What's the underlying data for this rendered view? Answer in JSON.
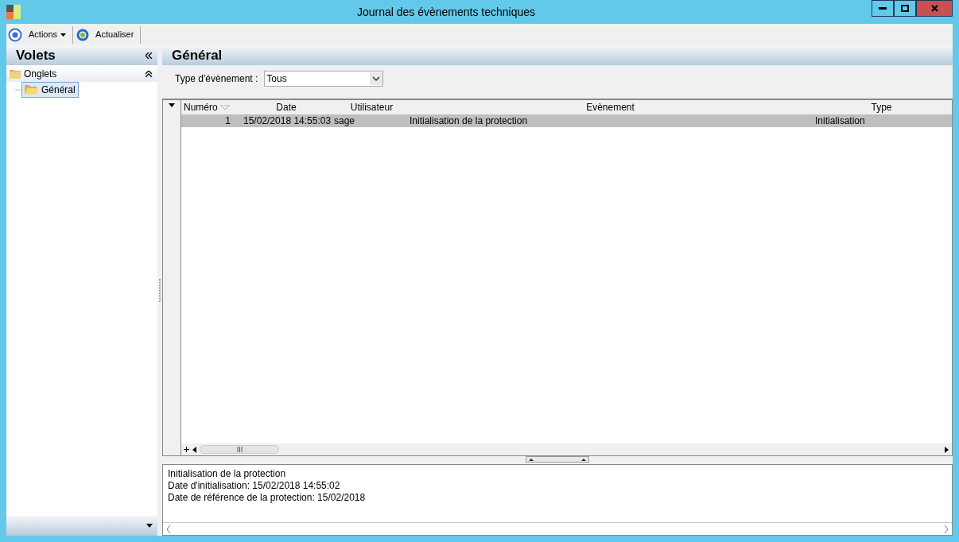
{
  "window": {
    "title": "Journal des évènements techniques"
  },
  "toolbar": {
    "items": [
      {
        "kind": "menu",
        "label": "Actions"
      },
      {
        "kind": "button",
        "label": "Actualiser"
      }
    ]
  },
  "sidebar": {
    "title": "Volets",
    "groups": [
      {
        "label": "Onglets",
        "expanded": true,
        "children": [
          {
            "label": "Général",
            "selected": true
          }
        ]
      }
    ]
  },
  "panel": {
    "title": "Général",
    "filter": {
      "label": "Type d'évènement :",
      "value": "Tous"
    }
  },
  "table": {
    "columns": [
      {
        "label": "Numéro",
        "sorted": true
      },
      {
        "label": "Date",
        "sorted": false
      },
      {
        "label": "Utilisateur",
        "sorted": false
      },
      {
        "label": "Evènement",
        "sorted": false
      },
      {
        "label": "Type",
        "sorted": false
      }
    ],
    "rows": [
      {
        "selected": true,
        "cells": [
          "1",
          "15/02/2018 14:55:03",
          "sage",
          "Initialisation de la protection",
          "Initialisation"
        ]
      }
    ]
  },
  "details": {
    "lines": [
      "Initialisation de la protection",
      "Date d'initialisation: 15/02/2018 14:55:02",
      "Date de référence de la protection: 15/02/2018"
    ]
  }
}
